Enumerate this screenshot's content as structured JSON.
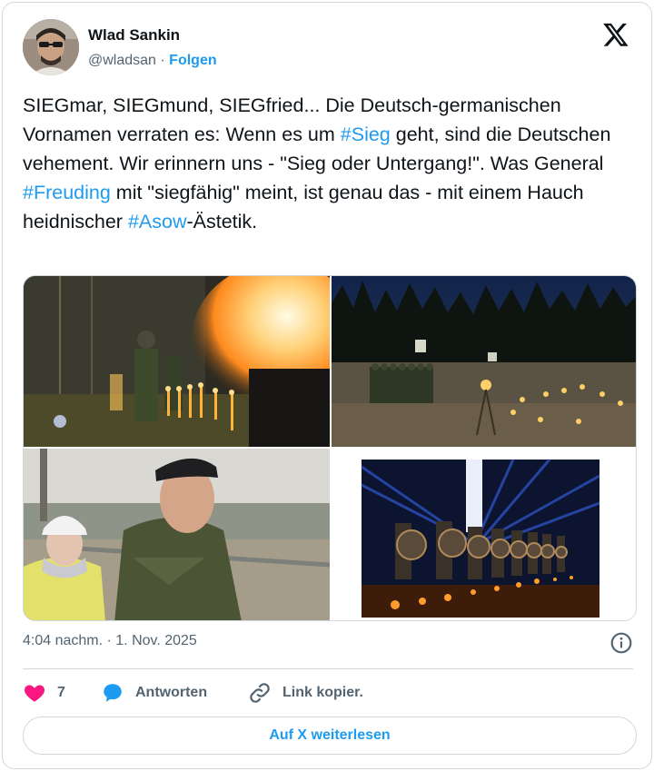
{
  "author": {
    "name": "Wlad Sankin",
    "handle": "@wladsan",
    "separator": " · ",
    "follow_label": "Folgen"
  },
  "tweet": {
    "segments": [
      {
        "text": "SIEGmar, SIEGmund, SIEGfried... Die Deutsch-germanischen Vornamen verraten es: Wenn es um ",
        "hashtag": false
      },
      {
        "text": "#Sieg",
        "hashtag": true
      },
      {
        "text": " geht, sind die Deutschen vehement. Wir erinnern uns - \"Sieg oder Untergang!\". Was General ",
        "hashtag": false
      },
      {
        "text": "#Freuding",
        "hashtag": true
      },
      {
        "text": " mit \"siegfähig\" meint, ist genau das - mit einem Hauch heidnischer ",
        "hashtag": false
      },
      {
        "text": "#Asow",
        "hashtag": true
      },
      {
        "text": "-Ästetik.",
        "hashtag": false
      }
    ]
  },
  "media": {
    "photos": [
      {
        "description": "Soldiers near large flames at night with torches"
      },
      {
        "description": "Formation of soldiers in a forest clearing with torches at dusk"
      },
      {
        "description": "Officer in beret next to worker in hard hat"
      },
      {
        "description": "Soldiers with round shields lit by torches and blue lights"
      }
    ]
  },
  "meta": {
    "time": "4:04 nachm.",
    "separator": " · ",
    "date": "1. Nov. 2025"
  },
  "actions": {
    "like_count": "7",
    "reply_label": "Antworten",
    "copy_link_label": "Link kopier."
  },
  "read_more_label": "Auf X weiterlesen",
  "colors": {
    "accent": "#1d9bf0",
    "heart": "#f91880",
    "text": "#0f1419",
    "muted": "#536471",
    "border": "#cfd9de"
  },
  "icons": [
    "x-logo-icon",
    "info-icon",
    "heart-icon",
    "reply-bubble-icon",
    "link-icon"
  ]
}
